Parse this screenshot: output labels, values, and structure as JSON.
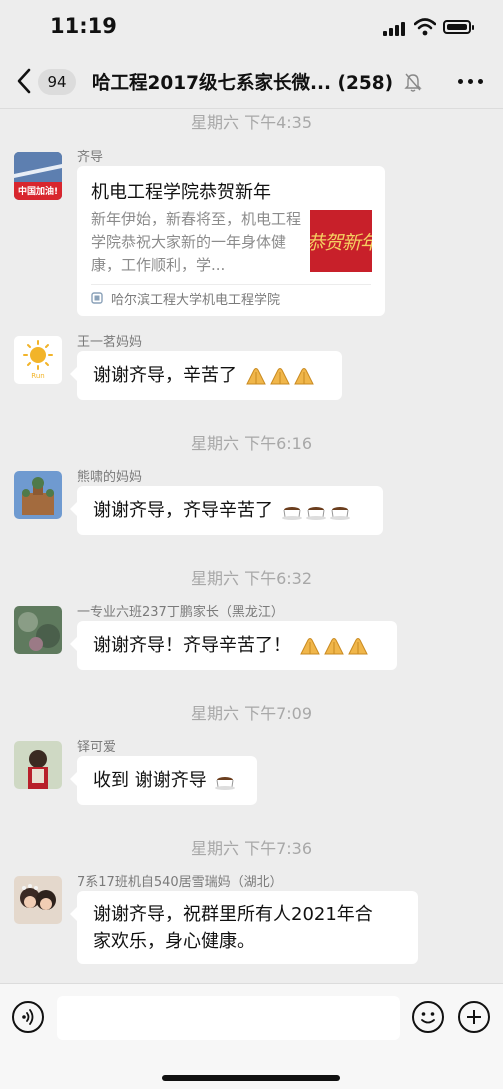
{
  "status_bar": {
    "time": "11:19"
  },
  "nav": {
    "back_icon": "chevron-left-icon",
    "unread_count": "94",
    "title": "哈工程2017级七系家长微...",
    "member_count": "(258)",
    "mute_icon": "bell-off-icon",
    "more_icon": "more-icon"
  },
  "chat": {
    "messages": [
      {
        "timestamp": "星期六 下午4:35",
        "sender": "齐导",
        "avatar_label": "中国加油!",
        "card": {
          "title": "机电工程学院恭贺新年",
          "description": "新年伊始，新春将至，机电工程学院恭祝大家新的一年身体健康，工作顺利，学...",
          "thumbnail_text": "恭贺新年",
          "source": "哈尔滨工程大学机电工程学院"
        }
      },
      {
        "sender": "王一茗妈妈",
        "avatar_label": "Run",
        "text": "谢谢齐导，辛苦了",
        "emoji": "clap-hands-icon",
        "emoji_count": 3
      },
      {
        "timestamp": "星期六 下午6:16",
        "sender": "熊啸的妈妈",
        "text": "谢谢齐导，齐导辛苦了",
        "emoji": "coffee-icon",
        "emoji_count": 3
      },
      {
        "timestamp": "星期六 下午6:32",
        "sender": "一专业六班237丁鹏家长（黑龙江）",
        "text": "谢谢齐导！齐导辛苦了！",
        "emoji": "clap-hands-icon",
        "emoji_count": 3
      },
      {
        "timestamp": "星期六 下午7:09",
        "sender": "铎可爱",
        "text": "收到 谢谢齐导",
        "emoji": "coffee-icon",
        "emoji_count": 1
      },
      {
        "timestamp": "星期六 下午7:36",
        "sender": "7系17班机自540居雪瑞妈（湖北）",
        "text_line1": "谢谢齐导，祝群里所有人2021年合",
        "text_line2": "家欢乐，身心健康。"
      }
    ]
  },
  "input_bar": {
    "voice_icon": "voice-icon",
    "emoji_icon": "smile-icon",
    "plus_icon": "plus-icon",
    "value": ""
  },
  "colors": {
    "background": "#ededed",
    "bubble": "#ffffff",
    "thumbnail": "#c8202a"
  }
}
